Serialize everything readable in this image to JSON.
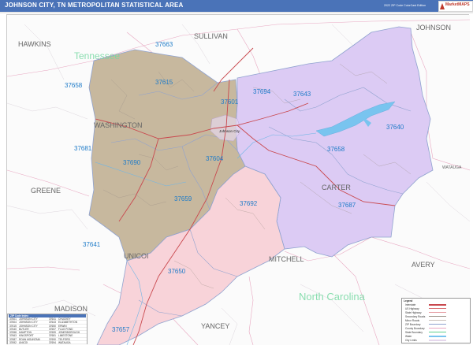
{
  "header": {
    "title": "JOHNSON CITY, TN METROPOLITAN STATISTICAL AREA",
    "edition": "2022 ZIP Code ColorCast Edition",
    "logo_text": "MarketMAPS"
  },
  "colors": {
    "header_bg": "#4a73b8",
    "washington_fill": "#c2b59c",
    "carter_fill": "#d9c8f2",
    "unicoi_fill": "#f7cfd6",
    "boundary": "#8fa2cf",
    "zip_label": "#1e7bc8",
    "county_label": "#555555",
    "state_label": "#5fcf8f",
    "lake": "#78c3ee",
    "road_red": "#c9484e"
  },
  "counties": {
    "washington": "WASHINGTON",
    "carter": "CARTER",
    "unicoi": "UNICOI",
    "hawkins": "HAWKINS",
    "sullivan": "SULLIVAN",
    "johnson": "JOHNSON",
    "greene": "GREENE",
    "mitchell": "MITCHELL",
    "avery": "AVERY",
    "madison": "MADISON",
    "yancey": "YANCEY",
    "watauga": "WATAUGA"
  },
  "states": {
    "tn": "Tennessee",
    "nc": "North Carolina"
  },
  "city": "Johnson City",
  "zips": {
    "z37663": "37663",
    "z37658a": "37658",
    "z37615": "37615",
    "z37601": "37601",
    "z37694": "37694",
    "z37643": "37643",
    "z37640": "37640",
    "z37658b": "37658",
    "z37681": "37681",
    "z37690": "37690",
    "z37604": "37604",
    "z37659": "37659",
    "z37692": "37692",
    "z37687": "37687",
    "z37641": "37641",
    "z37650": "37650",
    "z37657": "37657"
  },
  "legend": {
    "title": "Legend",
    "items": [
      "Interstate",
      "US Highway",
      "State Highway",
      "Secondary Roads",
      "Minor Roads",
      "ZIP Boundary",
      "County Boundary",
      "State Boundary",
      "Water",
      "City Limits"
    ]
  },
  "zip_table": {
    "title": "ZIP Code Index",
    "rows": [
      [
        "37601",
        "JOHNSON CITY",
        "37641",
        "CHUCKEY"
      ],
      [
        "37604",
        "JOHNSON CITY",
        "37643",
        "ELIZABETHTON"
      ],
      [
        "37615",
        "JOHNSON CITY",
        "37650",
        "ERWIN"
      ],
      [
        "37640",
        "BUTLER",
        "37657",
        "FLAG POND"
      ],
      [
        "37658",
        "HAMPTON",
        "37659",
        "JONESBOROUGH"
      ],
      [
        "37663",
        "KINGSPORT",
        "37681",
        "LIMESTONE"
      ],
      [
        "37687",
        "ROAN MOUNTAIN",
        "37690",
        "TELFORD"
      ],
      [
        "37692",
        "UNICOI",
        "37694",
        "WATAUGA"
      ]
    ]
  }
}
